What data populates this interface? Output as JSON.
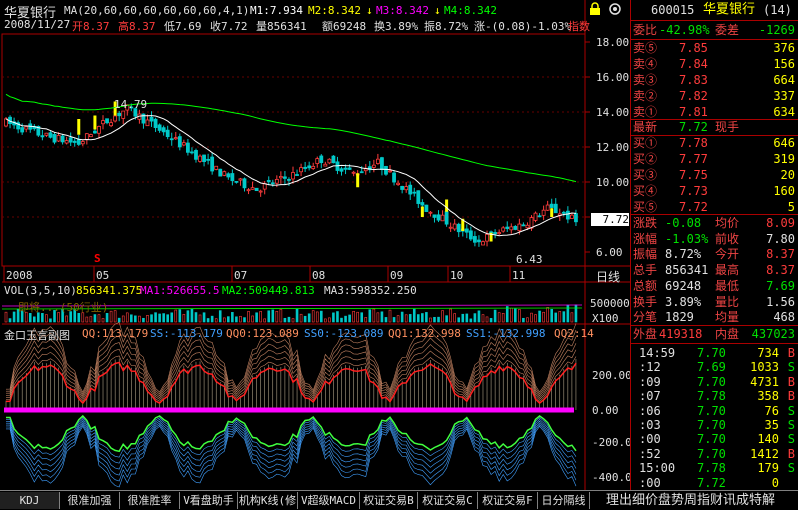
{
  "header": {
    "stock_name": "华夏银行",
    "ma_label": "MA(20,60,60,60,60,60,60,4,1)",
    "m1": "M1:7.934",
    "m2": "M2:8.342",
    "m3": "M3:8.342",
    "m4": "M4:8.342",
    "arrow_down": "↓",
    "date": "2008/11/27",
    "open": "开8.37",
    "high": "高8.37",
    "low": "低7.69",
    "close": "收7.72",
    "volume": "量856341",
    "amount": "额69248",
    "turnover": "换3.89%",
    "amplitude": "振8.72%",
    "change": "涨-(0.08)-1.03%",
    "index_label": "指数"
  },
  "price_axis": [
    "18.00",
    "16.00",
    "14.00",
    "12.00",
    "10.00",
    "8.00",
    "6.00"
  ],
  "current_price_tag": "7.72",
  "annotations": {
    "peak": "14.79",
    "low": "6.43",
    "s_marker": "S"
  },
  "date_axis": [
    "2008",
    "05",
    "07",
    "08",
    "09",
    "10",
    "11"
  ],
  "period_label": "日线",
  "volume_header": {
    "label": "VOL(3,5,10)",
    "vol": "856341.375",
    "ma1": "MA1:526655.5",
    "ma2": "MA2:509449.813",
    "ma3": "MA3:598352.250",
    "axis": "500000",
    "ghost": "即将...(50行业)"
  },
  "vol_axis_label": "X100",
  "indicator_header": {
    "name": "金口玉言副图",
    "qq": "QQ:113.179",
    "ss": "SS:-113.179",
    "qq0": "QQ0:123.089",
    "ss0": "SS0:-123.089",
    "qq1": "QQ1:132.998",
    "ss1": "SS1:-132.998",
    "qq2": "QQ2:14"
  },
  "indicator_axis": [
    "200.00",
    "0.00",
    "-200.00",
    "-400.00"
  ],
  "quote_panel": {
    "code": "600015",
    "name": "华夏银行",
    "suffix": "(14)",
    "weibi_label": "委比",
    "weibi": "-42.98%",
    "weicha_label": "委差",
    "weicha": "-1269",
    "sells": [
      {
        "label": "卖⑤",
        "price": "7.85",
        "vol": "376"
      },
      {
        "label": "卖④",
        "price": "7.84",
        "vol": "156"
      },
      {
        "label": "卖③",
        "price": "7.83",
        "vol": "664"
      },
      {
        "label": "卖②",
        "price": "7.82",
        "vol": "337"
      },
      {
        "label": "卖①",
        "price": "7.81",
        "vol": "634"
      }
    ],
    "latest_label": "最新",
    "latest": "7.72",
    "xianshou_label": "现手",
    "buys": [
      {
        "label": "买①",
        "price": "7.78",
        "vol": "646"
      },
      {
        "label": "买②",
        "price": "7.77",
        "vol": "319"
      },
      {
        "label": "买③",
        "price": "7.75",
        "vol": "20"
      },
      {
        "label": "买④",
        "price": "7.73",
        "vol": "160"
      },
      {
        "label": "买⑤",
        "price": "7.72",
        "vol": "5"
      }
    ],
    "stats": [
      {
        "l1": "涨跌",
        "v1": "-0.08",
        "c1": "grn",
        "l2": "均价",
        "v2": "8.09",
        "c2": "red"
      },
      {
        "l1": "涨幅",
        "v1": "-1.03%",
        "c1": "grn",
        "l2": "前收",
        "v2": "7.80",
        "c2": "wht"
      },
      {
        "l1": "振幅",
        "v1": "8.72%",
        "c1": "wht",
        "l2": "今开",
        "v2": "8.37",
        "c2": "red"
      },
      {
        "l1": "总手",
        "v1": "856341",
        "c1": "wht",
        "l2": "最高",
        "v2": "8.37",
        "c2": "red"
      },
      {
        "l1": "总额",
        "v1": "69248",
        "c1": "wht",
        "l2": "最低",
        "v2": "7.69",
        "c2": "grn"
      },
      {
        "l1": "换手",
        "v1": "3.89%",
        "c1": "wht",
        "l2": "量比",
        "v2": "1.56",
        "c2": "wht"
      },
      {
        "l1": "分笔",
        "v1": "1829",
        "c1": "wht",
        "l2": "均量",
        "v2": "468",
        "c2": "wht"
      }
    ],
    "waipan_label": "外盘",
    "waipan": "419318",
    "neipan_label": "内盘",
    "neipan": "437023",
    "ticks": [
      {
        "t": "14:59",
        "p": "7.70",
        "pc": "grn",
        "v": "734",
        "d": "B",
        "dc": "red"
      },
      {
        "t": ":12",
        "p": "7.69",
        "pc": "grn",
        "v": "1033",
        "d": "S",
        "dc": "grn"
      },
      {
        "t": ":09",
        "p": "7.70",
        "pc": "grn",
        "v": "4731",
        "d": "B",
        "dc": "red"
      },
      {
        "t": ":07",
        "p": "7.78",
        "pc": "grn",
        "v": "358",
        "d": "B",
        "dc": "red"
      },
      {
        "t": ":06",
        "p": "7.70",
        "pc": "grn",
        "v": "76",
        "d": "S",
        "dc": "grn"
      },
      {
        "t": ":03",
        "p": "7.70",
        "pc": "grn",
        "v": "35",
        "d": "S",
        "dc": "grn"
      },
      {
        "t": ":00",
        "p": "7.70",
        "pc": "grn",
        "v": "140",
        "d": "S",
        "dc": "grn"
      },
      {
        "t": ":52",
        "p": "7.70",
        "pc": "grn",
        "v": "1412",
        "d": "B",
        "dc": "red"
      },
      {
        "t": "15:00",
        "p": "7.78",
        "pc": "grn",
        "v": "179",
        "d": "S",
        "dc": "grn"
      },
      {
        "t": ":00",
        "p": "7.72",
        "pc": "grn",
        "v": "0",
        "d": "",
        "dc": "wht"
      }
    ]
  },
  "tabs": [
    "KDJ",
    "很准加强",
    "很准胜率",
    "V看盘助手",
    "机构K线(修",
    "V超级MACD",
    "权证交易B",
    "权证交易C",
    "权证交易F",
    "日分隔线"
  ],
  "scroll_text": "理出细价盘势周指财讯成特解",
  "colors": {
    "up": "#ff3c3c",
    "down": "#00c8c8",
    "ma_white": "#ffffff",
    "ma_green": "#00ff00",
    "magenta": "#ff00ff",
    "yellow": "#ffff00"
  }
}
